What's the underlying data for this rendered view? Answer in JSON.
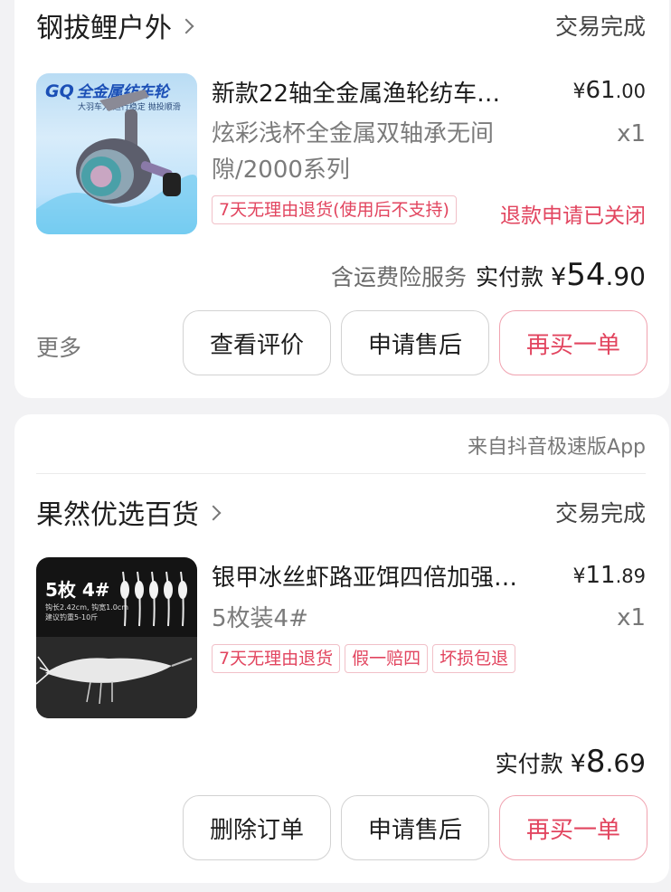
{
  "orders": [
    {
      "shop": "钢拔鲤户外",
      "status": "交易完成",
      "thumb": {
        "brand_gq": "GQ",
        "brand": "全金属纺车轮",
        "sub": "大羽车力 运行稳定 抛投顺滑"
      },
      "title": "新款22轴全金属渔轮纺车…",
      "price": {
        "symbol": "¥",
        "int": "61",
        "dec": ".00"
      },
      "spec": "炫彩浅杯全金属双轴承无间隙/2000系列",
      "qty": "x1",
      "tags": [
        "7天无理由退货(使用后不支持)"
      ],
      "refund_status": "退款申请已关闭",
      "insurance": "含运费险服务",
      "paid_label": "实付款",
      "paid": {
        "symbol": "¥",
        "int": "54",
        "dec": ".90"
      },
      "more": "更多",
      "buttons": [
        "查看评价",
        "申请售后",
        "再买一单"
      ]
    },
    {
      "source": "来自抖音极速版App",
      "shop": "果然优选百货",
      "status": "交易完成",
      "thumb": {
        "big": "5枚 4#",
        "line1": "钩长2.42cm, 钩宽1.0cm",
        "line2": "建议钓重5-10斤"
      },
      "title": "银甲冰丝虾路亚饵四倍加强…",
      "price": {
        "symbol": "¥",
        "int": "11",
        "dec": ".89"
      },
      "spec": "5枚装4#",
      "qty": "x1",
      "tags": [
        "7天无理由退货",
        "假一赔四",
        "坏损包退"
      ],
      "paid_label": "实付款",
      "paid": {
        "symbol": "¥",
        "int": "8",
        "dec": ".69"
      },
      "buttons": [
        "删除订单",
        "申请售后",
        "再买一单"
      ]
    }
  ],
  "colors": {
    "accent": "#e2455f",
    "background": "#f2f2f4"
  }
}
